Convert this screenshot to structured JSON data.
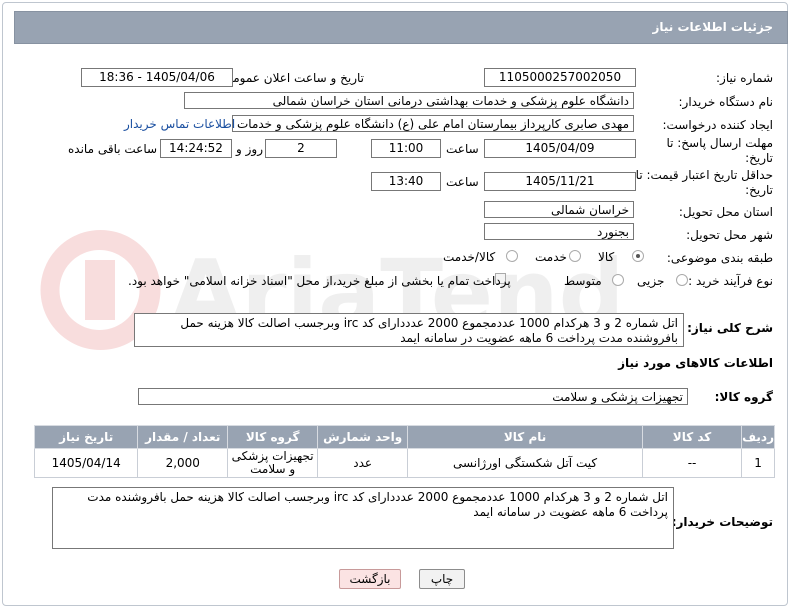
{
  "header": {
    "title": "جزئیات اطلاعات نیاز"
  },
  "fields": {
    "need_number_label": "شماره نیاز:",
    "need_number": "1105000257002050",
    "announce_label": "تاریخ و ساعت اعلان عمومی:",
    "announce_value": "1405/04/06 - 18:36",
    "buyer_org_label": "نام دستگاه خریدار:",
    "buyer_org": "دانشگاه علوم پزشکی و خدمات بهداشتی درمانی استان خراسان شمالی",
    "requester_label": "ایجاد کننده درخواست:",
    "requester": "مهدی صابری کارپرداز بیمارستان امام علی (ع) دانشگاه علوم پزشکی و خدمات ب",
    "contact_link": "اطلاعات تماس خریدار",
    "deadline_label": "مهلت ارسال پاسخ: تا تاریخ:",
    "deadline_date": "1405/04/09",
    "time_word": "ساعت",
    "deadline_time": "11:00",
    "days": "2",
    "days_word": "روز و",
    "remaining": "14:24:52",
    "remaining_word": "ساعت باقی مانده",
    "validity_label": "حداقل تاریخ اعتبار قیمت: تا تاریخ:",
    "validity_date": "1405/11/21",
    "validity_time": "13:40",
    "province_label": "استان محل تحویل:",
    "province": "خراسان شمالی",
    "city_label": "شهر محل تحویل:",
    "city": "بجنورد",
    "category_label": "طبقه بندی موضوعی:",
    "category_options": [
      "کالا",
      "خدمت",
      "کالا/خدمت"
    ],
    "process_label": "نوع فرآیند خرید :",
    "process_options": [
      "جزیی",
      "متوسط"
    ],
    "payment_note": "پرداخت تمام یا بخشی از مبلغ خرید،از محل \"اسناد خزانه اسلامی\" خواهد بود."
  },
  "description": {
    "label": "شرح کلی نیاز:",
    "text": "اتل شماره 2 و 3 هرکدام 1000 عددمجموع 2000 عدددارای کد irc وبرجسب اصالت کالا هزینه حمل بافروشنده مدت پرداخت 6 ماهه عضویت در سامانه ایمد"
  },
  "goods": {
    "section_title": "اطلاعات کالاهای مورد نیاز",
    "group_label": "گروه کالا:",
    "group_value": "تجهیزات پزشکی و سلامت"
  },
  "table": {
    "headers": [
      "ردیف",
      "کد کالا",
      "نام کالا",
      "واحد شمارش",
      "گروه کالا",
      "تعداد / مقدار",
      "تاریخ نیاز"
    ],
    "rows": [
      [
        "1",
        "--",
        "کیت آتل شکستگی اورژانسی",
        "عدد",
        "تجهیزات پزشکی و سلامت",
        "2,000",
        "1405/04/14"
      ]
    ]
  },
  "buyer_notes": {
    "label": "توضیحات خریدار:",
    "text": "اتل شماره 2 و 3 هرکدام 1000 عددمجموع 2000 عدددارای کد irc وبرجسب اصالت کالا هزینه حمل بافروشنده مدت پرداخت 6 ماهه عضویت در سامانه ایمد"
  },
  "buttons": {
    "print": "چاپ",
    "back": "بازگشت"
  },
  "watermark": {
    "text": "AriaTender.neT"
  }
}
